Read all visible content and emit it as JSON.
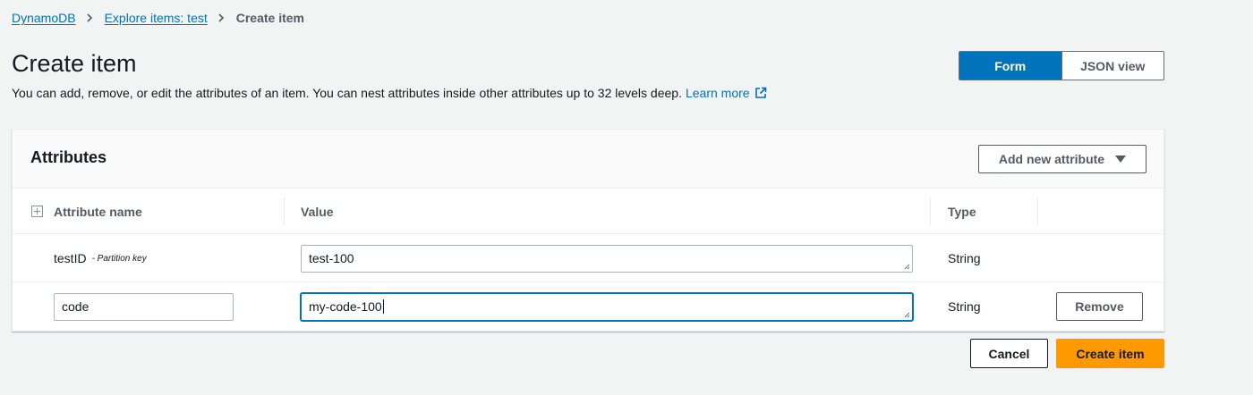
{
  "breadcrumb": {
    "items": [
      "DynamoDB",
      "Explore items: test"
    ],
    "current": "Create item"
  },
  "header": {
    "title": "Create item",
    "description": "You can add, remove, or edit the attributes of an item. You can nest attributes inside other attributes up to 32 levels deep.",
    "learn_more": "Learn more"
  },
  "view_toggle": {
    "options": [
      "Form",
      "JSON view"
    ],
    "selected": "Form"
  },
  "attributes": {
    "title": "Attributes",
    "add_button": "Add new attribute",
    "columns": [
      "Attribute name",
      "Value",
      "Type"
    ],
    "rows": [
      {
        "name": "testID",
        "note": "- Partition key",
        "value": "test-100",
        "type": "String"
      },
      {
        "name": "code",
        "value": "my-code-100",
        "type": "String",
        "remove": "Remove"
      }
    ]
  },
  "footer": {
    "cancel": "Cancel",
    "create": "Create item"
  },
  "colors": {
    "accent": "#0073bb",
    "primary_button": "#ff9900",
    "background": "#f2f3f3"
  }
}
